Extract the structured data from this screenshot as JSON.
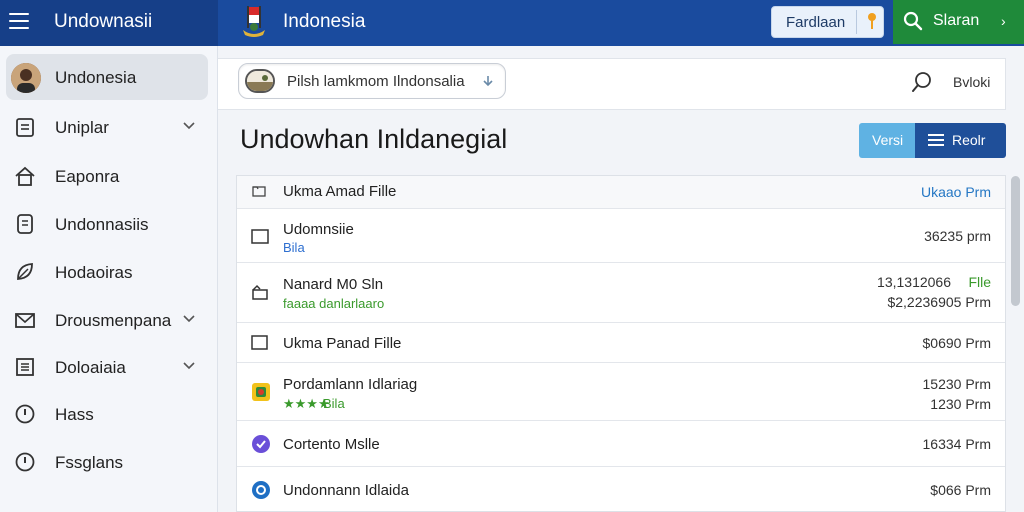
{
  "app": {
    "title": "Undownasii",
    "top_title": "Indonesia"
  },
  "topbar": {
    "button_label": "Fardlaan",
    "search_label": "Slaran"
  },
  "sidebar": {
    "items": [
      {
        "label": "Undonesia"
      },
      {
        "label": "Uniplar"
      },
      {
        "label": "Eaponra"
      },
      {
        "label": "Undonnasiis"
      },
      {
        "label": "Hodaoiras"
      },
      {
        "label": "Drousmenpana"
      },
      {
        "label": "Doloaiaia"
      },
      {
        "label": "Hass"
      },
      {
        "label": "Fssglans"
      }
    ]
  },
  "search": {
    "value": "Pilsh lamkmom Ilndonsalia",
    "sort_label": "Bvloki"
  },
  "main": {
    "page_title": "Undowhan Inldanegial",
    "btn_versi": "Versi",
    "btn_reol": "Reolr"
  },
  "list": {
    "header": {
      "title": "Ukma Amad Fille",
      "right": "Ukaao Prm"
    },
    "rows": [
      {
        "title": "Udomnsiie",
        "sub": "Bila",
        "right": "36235 prm"
      },
      {
        "title": "Nanard M0 Sln",
        "sub": "faaaa danlarlaaro",
        "right": "13,1312066",
        "right_extra": "Flle",
        "right2": "$2,2236905 Prm"
      },
      {
        "title": "Ukma Panad Fille",
        "right": "$0690 Prm"
      },
      {
        "title": "Pordamlann Idlariag",
        "stars": "★★★★",
        "sub": "Bila",
        "right": "15230 Prm",
        "right2": "1230 Prm"
      },
      {
        "title": "Cortento Mslle",
        "right": "16334 Prm"
      },
      {
        "title": "Undonnann Idlaida",
        "right": "$066 Prm"
      }
    ]
  },
  "colors": {
    "topbar": "#1a4b9e",
    "accent_green": "#1f8a3a",
    "sub_blue": "#2e6fd0",
    "sub_green": "#3a9a2c"
  }
}
